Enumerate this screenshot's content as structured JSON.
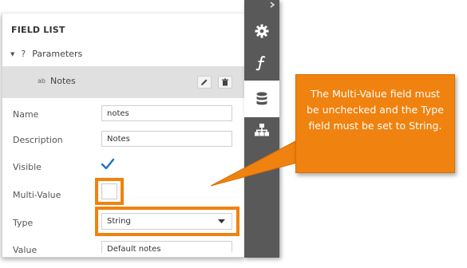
{
  "panel": {
    "title": "FIELD LIST",
    "tree_root_label": "Parameters",
    "selected_item_label": "Notes",
    "selected_item_type_glyph": "ab"
  },
  "form": {
    "name": {
      "label": "Name",
      "value": "notes"
    },
    "description": {
      "label": "Description",
      "value": "Notes"
    },
    "visible": {
      "label": "Visible",
      "checked": true
    },
    "multi_value": {
      "label": "Multi-Value",
      "checked": false
    },
    "type": {
      "label": "Type",
      "value": "String"
    },
    "value": {
      "label": "Value",
      "value": "Default notes"
    }
  },
  "sidebar": {
    "tabs": [
      {
        "icon": "gear-icon",
        "active": false
      },
      {
        "icon": "function-icon",
        "active": false
      },
      {
        "icon": "database-icon",
        "active": true
      },
      {
        "icon": "hierarchy-icon",
        "active": false
      }
    ]
  },
  "callout": {
    "text": "The Multi-Value field must be unchecked and the Type field must be set to String."
  },
  "colors": {
    "accent_orange": "#f0820f",
    "sidebar_bg": "#595959",
    "selected_row_bg": "#e0e0e0",
    "check_blue": "#1e73be"
  }
}
